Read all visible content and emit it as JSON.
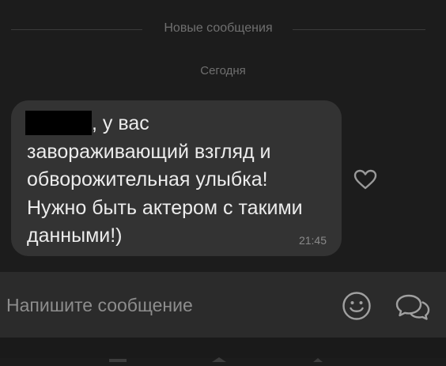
{
  "divider": {
    "label": "Новые сообщения"
  },
  "date": {
    "label": "Сегодня"
  },
  "message": {
    "text_after_redaction": ", у вас",
    "text_rest": "завораживающий взгляд и обворожительная улыбка! Нужно быть актером с такими данными!)",
    "time": "21:45"
  },
  "icons": {
    "like": "heart-icon",
    "emoji": "smiley-icon",
    "quick_reply": "chat-bubbles-icon"
  },
  "composer": {
    "placeholder": "Напишите сообщение"
  },
  "colors": {
    "background": "#1c1c1c",
    "bubble": "#333333",
    "composer": "#2b2b2b",
    "text": "#ececec",
    "muted": "#6f6f6f"
  }
}
